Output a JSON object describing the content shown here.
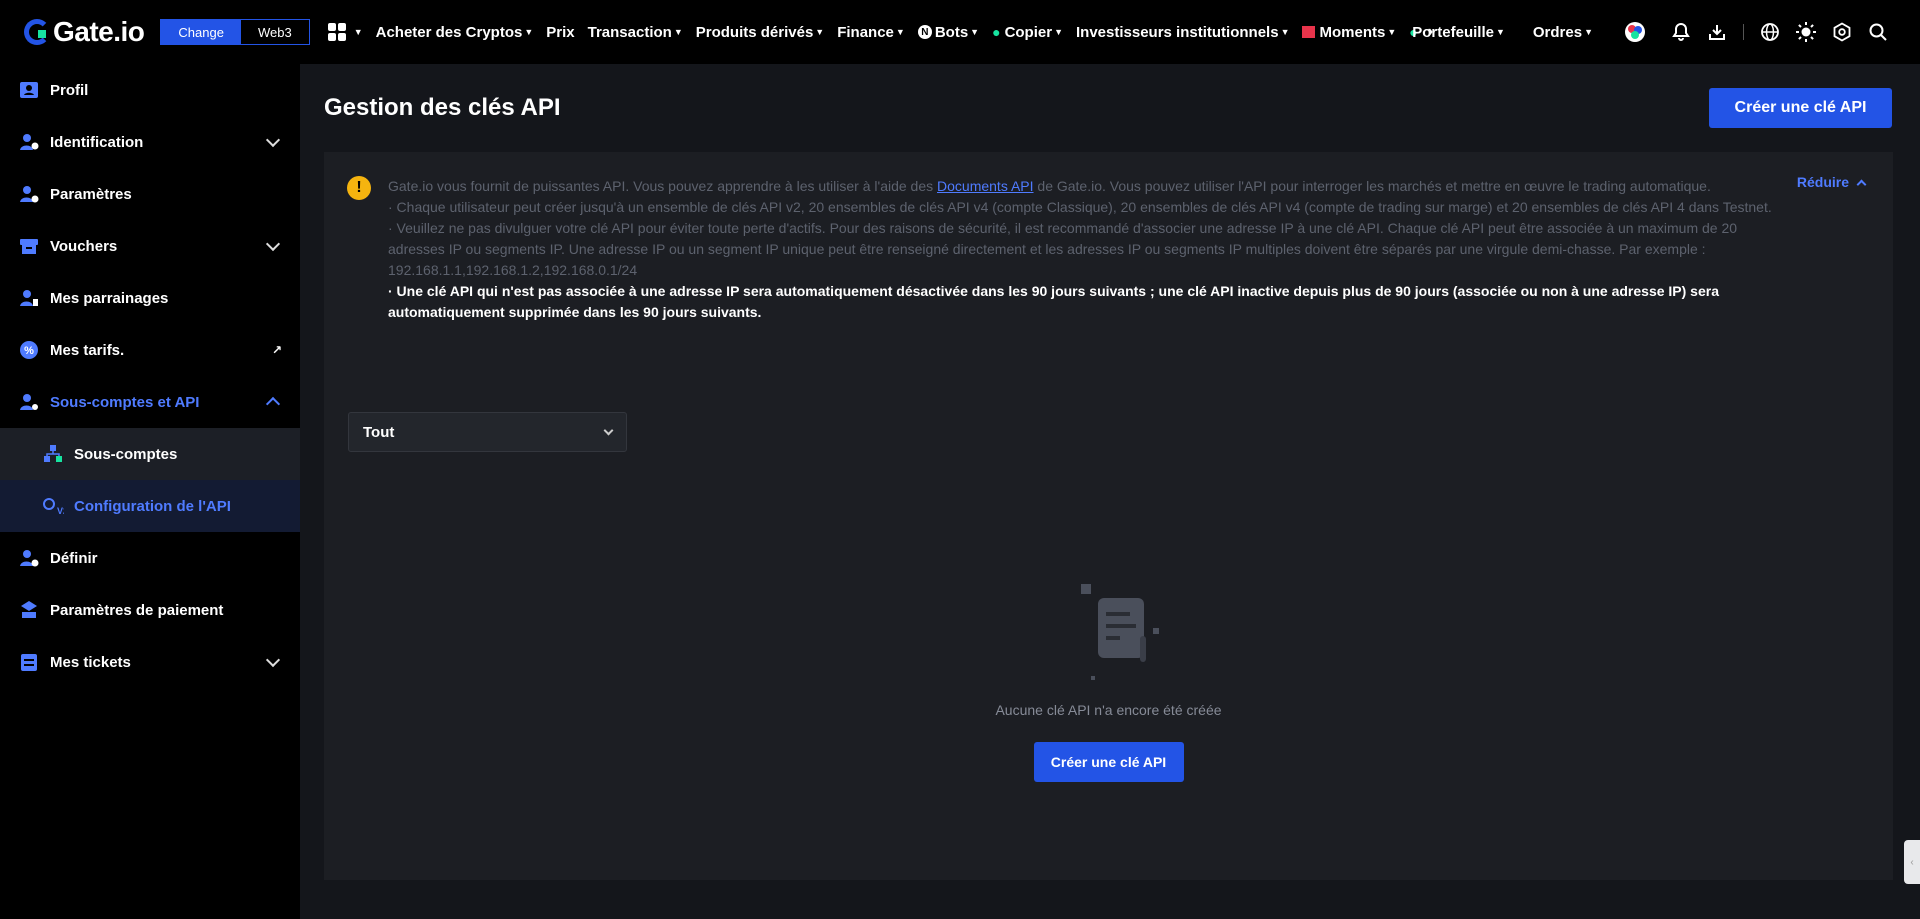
{
  "brand": {
    "name": "Gate.io"
  },
  "mode_switch": {
    "change": "Change",
    "web3": "Web3"
  },
  "nav": {
    "items": [
      {
        "label": "Acheter des Cryptos"
      },
      {
        "label": "Prix"
      },
      {
        "label": "Transaction"
      },
      {
        "label": "Produits dérivés"
      },
      {
        "label": "Finance"
      },
      {
        "label": "Bots",
        "badge": "N"
      },
      {
        "label": "Copier"
      },
      {
        "label": "Investisseurs institutionnels"
      },
      {
        "label": "Moments"
      }
    ],
    "right": {
      "wallet": "Portefeuille",
      "orders": "Ordres"
    }
  },
  "sidebar": {
    "items": [
      {
        "label": "Profil"
      },
      {
        "label": "Identification"
      },
      {
        "label": "Paramètres"
      },
      {
        "label": "Vouchers"
      },
      {
        "label": "Mes parrainages"
      },
      {
        "label": "Mes tarifs."
      },
      {
        "label": "Sous-comptes et API"
      },
      {
        "label": "Sous-comptes"
      },
      {
        "label": "Configuration de l'API"
      },
      {
        "label": "Définir"
      },
      {
        "label": "Paramètres de paiement"
      },
      {
        "label": "Mes tickets"
      }
    ]
  },
  "main": {
    "title": "Gestion des clés API",
    "create_button": "Créer une clé API",
    "notice": {
      "collapse_label": "Réduire",
      "intro_before_link": "Gate.io vous fournit de puissantes API. Vous pouvez apprendre à les utiliser à l'aide des ",
      "link_text": "Documents API",
      "intro_after_link": " de Gate.io. Vous pouvez utiliser l'API pour interroger les marchés et mettre en œuvre le trading automatique.",
      "line2": "· Chaque utilisateur peut créer jusqu'à un ensemble de clés API v2, 20 ensembles de clés API v4 (compte Classique), 20 ensembles de clés API v4 (compte de trading sur marge) et 20 ensembles de clés API 4 dans Testnet.",
      "line3": "· Veuillez ne pas divulguer votre clé API pour éviter toute perte d'actifs. Pour des raisons de sécurité, il est recommandé d'associer une adresse IP à une clé API. Chaque clé API peut être associée à un maximum de 20 adresses IP ou segments IP. Une adresse IP ou un segment IP unique peut être renseigné directement et les adresses IP ou segments IP multiples doivent être séparés par une virgule demi-chasse. Par exemple : 192.168.1.1,192.168.1.2,192.168.0.1/24",
      "line4": "· Une clé API qui n'est pas associée à une adresse IP sera automatiquement désactivée dans les 90 jours suivants ; une clé API inactive depuis plus de 90 jours (associée ou non à une adresse IP) sera automatiquement supprimée dans les 90 jours suivants."
    },
    "filter": {
      "selected": "Tout"
    },
    "empty": {
      "message": "Aucune clé API n'a encore été créée",
      "button": "Créer une clé API"
    }
  },
  "colors": {
    "accent": "#2354e6",
    "link": "#4f7bff",
    "warning": "#f5b40f",
    "green": "#17e3a0"
  }
}
